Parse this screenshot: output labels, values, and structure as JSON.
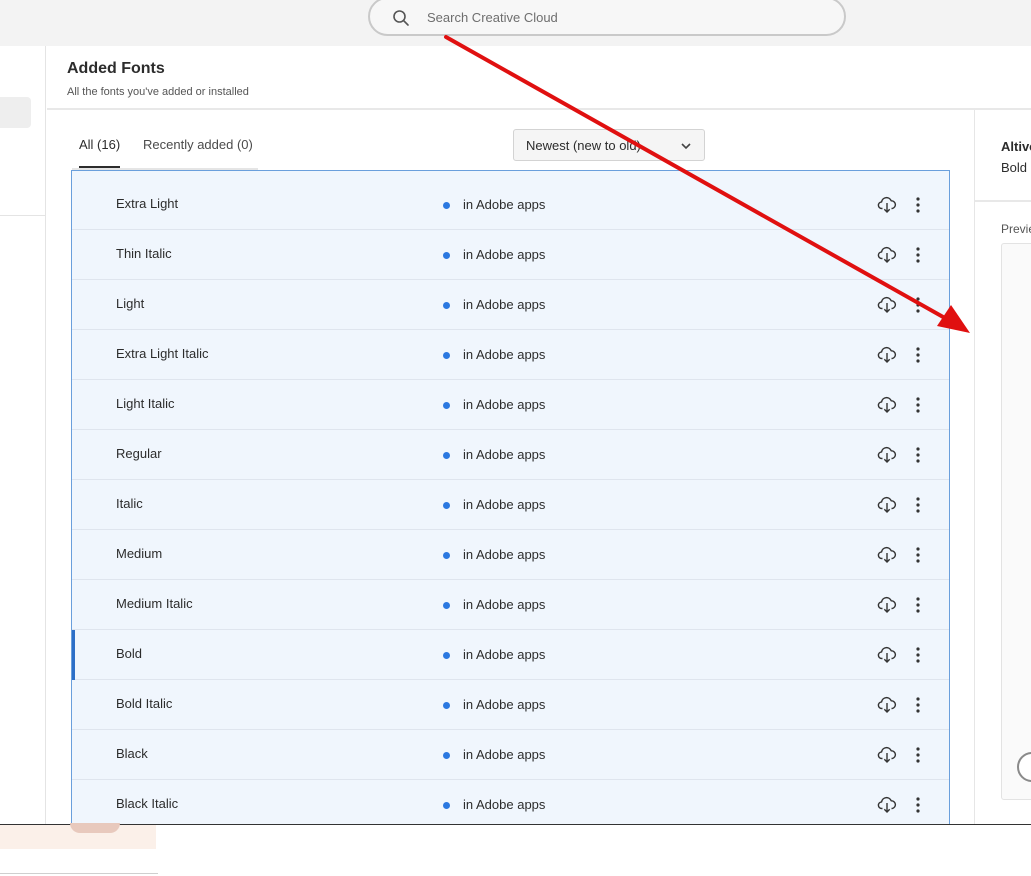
{
  "search": {
    "placeholder": "Search Creative Cloud"
  },
  "header": {
    "title": "Added Fonts",
    "subtitle": "All the fonts you've added or installed"
  },
  "tabs": [
    {
      "label": "All (16)",
      "active": true
    },
    {
      "label": "Recently added (0)",
      "active": false
    }
  ],
  "sort": {
    "selected": "Newest (new to old)"
  },
  "fonts": [
    {
      "name": "Extra Light",
      "status": "in Adobe apps"
    },
    {
      "name": "Thin Italic",
      "status": "in Adobe apps"
    },
    {
      "name": "Light",
      "status": "in Adobe apps"
    },
    {
      "name": "Extra Light Italic",
      "status": "in Adobe apps"
    },
    {
      "name": "Light Italic",
      "status": "in Adobe apps"
    },
    {
      "name": "Regular",
      "status": "in Adobe apps"
    },
    {
      "name": "Italic",
      "status": "in Adobe apps"
    },
    {
      "name": "Medium",
      "status": "in Adobe apps"
    },
    {
      "name": "Medium Italic",
      "status": "in Adobe apps"
    },
    {
      "name": "Bold",
      "status": "in Adobe apps",
      "selected": true
    },
    {
      "name": "Bold Italic",
      "status": "in Adobe apps"
    },
    {
      "name": "Black",
      "status": "in Adobe apps"
    },
    {
      "name": "Black Italic",
      "status": "in Adobe apps"
    }
  ],
  "detail": {
    "family": "Altivo",
    "style": "Bold",
    "preview_label": "Previe"
  },
  "colors": {
    "status_dot": "#2b78e0",
    "selection": "#2d6fc7",
    "row_bg": "#f0f6fd",
    "arrow": "#e01010"
  },
  "icons": {
    "search": "search-icon",
    "cloud": "cloud-download-icon",
    "more": "more-vertical-icon",
    "chevron": "chevron-down-icon"
  }
}
